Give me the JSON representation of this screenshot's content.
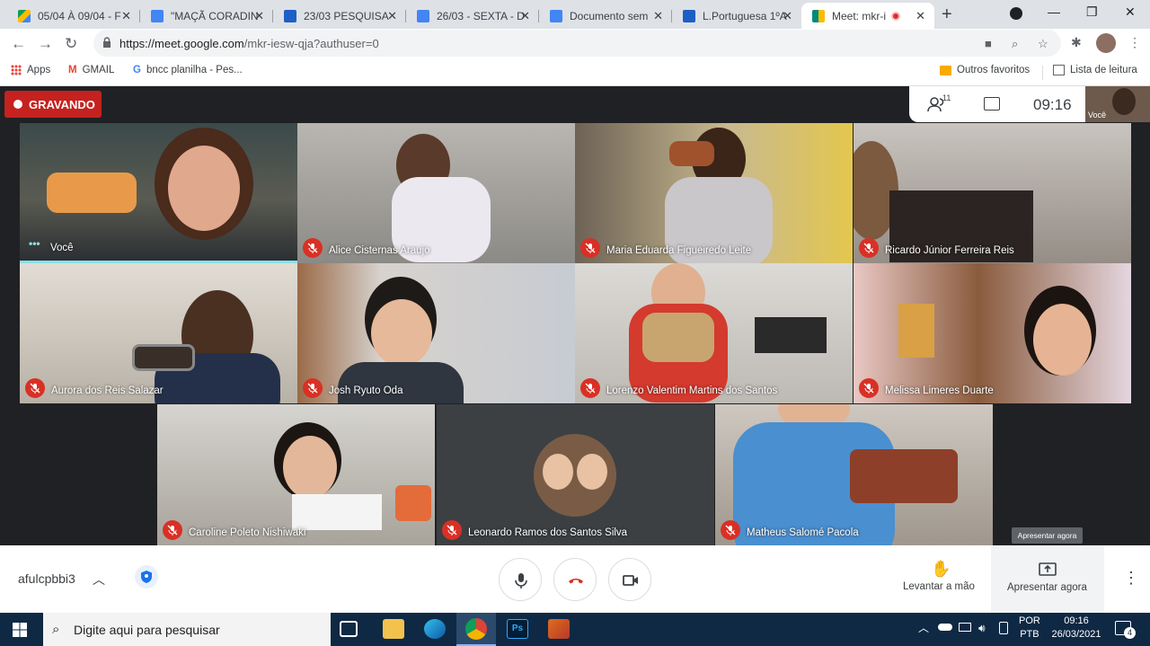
{
  "browser": {
    "tabs": [
      {
        "label": "05/04 À 09/04 - F",
        "icon": "google-drive-icon",
        "color": "#0f9d58"
      },
      {
        "label": "\"MAÇÃ CORADIN",
        "icon": "google-docs-icon",
        "color": "#4285f4"
      },
      {
        "label": "23/03 PESQUISA",
        "icon": "google-classroom-icon",
        "color": "#1e5fc6"
      },
      {
        "label": "26/03 - SEXTA - D",
        "icon": "google-docs-icon",
        "color": "#4285f4"
      },
      {
        "label": "Documento sem",
        "icon": "google-docs-icon",
        "color": "#4285f4"
      },
      {
        "label": "L.Portuguesa 1ºA",
        "icon": "google-classroom-icon",
        "color": "#1e5fc6"
      },
      {
        "label": "Meet: mkr-ie",
        "icon": "google-meet-icon",
        "color": "#00897b"
      }
    ],
    "url_host": "https://meet.google.com",
    "url_path": "/mkr-iesw-qja?authuser=0",
    "bookmarks": [
      "Apps",
      "GMAIL",
      "bncc planilha - Pes..."
    ],
    "other_bookmarks": "Outros favoritos",
    "reading_list": "Lista de leitura"
  },
  "meet": {
    "recording_label": "GRAVANDO",
    "participant_count": "11",
    "time": "09:16",
    "self_preview_label": "Você",
    "tooltip": "Apresentar agora",
    "meeting_code": "afulcpbbi3",
    "raise_hand_label": "Levantar a mão",
    "present_label": "Apresentar agora",
    "participants": [
      {
        "name": "Você",
        "muted": false
      },
      {
        "name": "Alice Cisternas Araujo",
        "muted": true
      },
      {
        "name": "Maria Eduarda Figueiredo Leite",
        "muted": true
      },
      {
        "name": "Ricardo Júnior Ferreira Reis",
        "muted": true
      },
      {
        "name": "Aurora dos Reis Salazar",
        "muted": true
      },
      {
        "name": "Josh Ryuto Oda",
        "muted": true
      },
      {
        "name": "Lorenzo Valentim Martins dos Santos",
        "muted": true
      },
      {
        "name": "Melissa Limeres Duarte",
        "muted": true
      },
      {
        "name": "Caroline Poleto Nishiwaki",
        "muted": true
      },
      {
        "name": "Leonardo Ramos dos Santos Silva",
        "muted": true
      },
      {
        "name": "Matheus Salomé Pacola",
        "muted": true
      }
    ]
  },
  "taskbar": {
    "search_placeholder": "Digite aqui para pesquisar",
    "lang_line1": "POR",
    "lang_line2": "PTB",
    "clock_time": "09:16",
    "clock_date": "26/03/2021",
    "notifications": "4"
  }
}
